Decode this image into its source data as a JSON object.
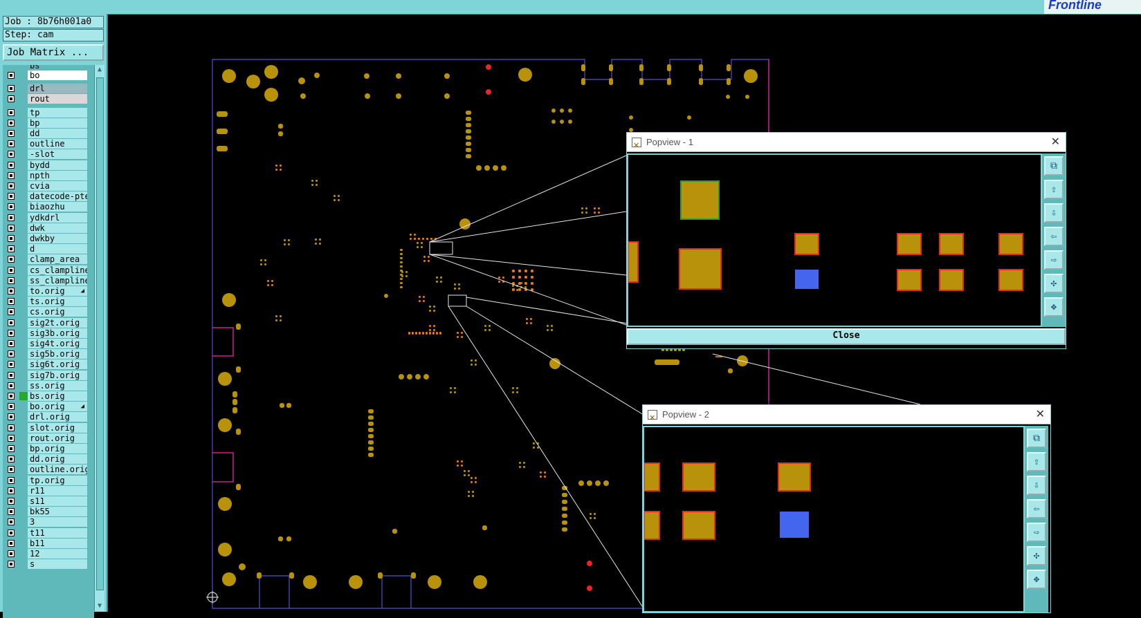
{
  "app": {
    "logo_text": "Frontline"
  },
  "panel": {
    "job": "Job : 8b76h001a0",
    "step": "Step: cam",
    "job_matrix": "Job Matrix ...",
    "partial_top": "bs",
    "layers": [
      {
        "name": "bo",
        "style": "white"
      },
      {
        "name": "drl",
        "style": "grey"
      },
      {
        "name": "rout",
        "style": "lgrey"
      },
      {
        "name": "tp"
      },
      {
        "name": "bp"
      },
      {
        "name": "dd"
      },
      {
        "name": "outline"
      },
      {
        "name": "-slot"
      },
      {
        "name": "bydd"
      },
      {
        "name": "npth"
      },
      {
        "name": "cvia"
      },
      {
        "name": "datecode-pte"
      },
      {
        "name": "biaozhu"
      },
      {
        "name": "ydkdrl"
      },
      {
        "name": "dwk"
      },
      {
        "name": "dwkby"
      },
      {
        "name": "d"
      },
      {
        "name": "clamp_area"
      },
      {
        "name": "cs_clampline"
      },
      {
        "name": "ss_clampline"
      },
      {
        "name": "to.orig",
        "arrow": true
      },
      {
        "name": "ts.orig"
      },
      {
        "name": "cs.orig"
      },
      {
        "name": "sig2t.orig"
      },
      {
        "name": "sig3b.orig"
      },
      {
        "name": "sig4t.orig"
      },
      {
        "name": "sig5b.orig"
      },
      {
        "name": "sig6t.orig"
      },
      {
        "name": "sig7b.orig"
      },
      {
        "name": "ss.orig"
      },
      {
        "name": "bs.orig",
        "mark": true
      },
      {
        "name": "bo.orig",
        "arrow": true
      },
      {
        "name": "drl.orig"
      },
      {
        "name": "slot.orig"
      },
      {
        "name": "rout.orig"
      },
      {
        "name": "bp.orig"
      },
      {
        "name": "dd.orig"
      },
      {
        "name": "outline.orig"
      },
      {
        "name": "tp.orig"
      },
      {
        "name": "r11"
      },
      {
        "name": "s11"
      },
      {
        "name": "bk55"
      },
      {
        "name": "3"
      },
      {
        "name": "t11"
      },
      {
        "name": "b11"
      },
      {
        "name": "12"
      },
      {
        "name": "s"
      }
    ]
  },
  "popview1": {
    "title": "Popview - 1",
    "close_label": "Close"
  },
  "popview2": {
    "title": "Popview - 2"
  },
  "tools": [
    {
      "icon": "zoom-fit-icon",
      "glyph": "⧉"
    },
    {
      "icon": "pan-up-icon",
      "glyph": "⇧"
    },
    {
      "icon": "pan-down-icon",
      "glyph": "⇩"
    },
    {
      "icon": "pan-left-icon",
      "glyph": "⇦"
    },
    {
      "icon": "pan-right-icon",
      "glyph": "⇨"
    },
    {
      "icon": "zoom-out-icon",
      "glyph": "✣"
    },
    {
      "icon": "zoom-in-icon",
      "glyph": "✥"
    }
  ],
  "colors": {
    "pad": "#b8920a",
    "pad_selected": "#e8281e",
    "highlight": "#4466ee",
    "outline": "#5050d8",
    "board_edge": "#d0208a"
  }
}
